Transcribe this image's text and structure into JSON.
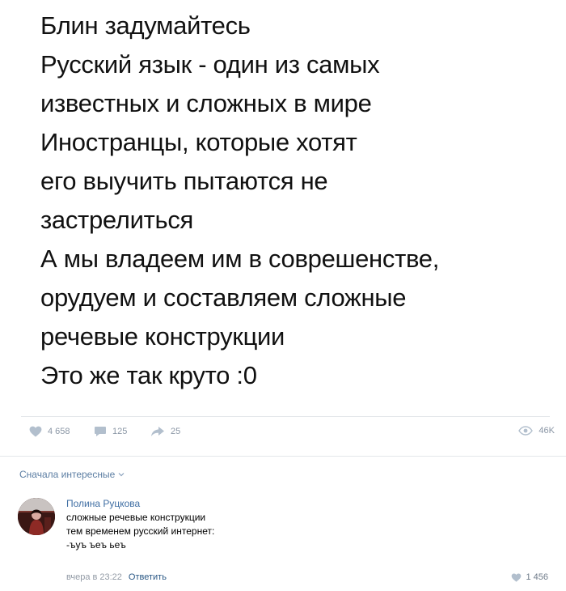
{
  "post": {
    "lines": [
      "Блин задумайтесь",
      "Русский язык - один из самых",
      "известных и сложных в мире",
      "Иностранцы, которые хотят",
      "его выучить пытаются не",
      "застрелиться",
      "А мы владеем им в соврешенстве,",
      "орудуем и составляем сложные",
      "речевые конструкции",
      "Это же так круто :0"
    ]
  },
  "actions": {
    "likes": "4 658",
    "comments": "125",
    "shares": "25",
    "views": "46K",
    "icons": [
      "heart-icon",
      "comment-icon",
      "share-icon",
      "eye-icon"
    ]
  },
  "comments_sort": {
    "label": "Сначала интересные"
  },
  "comment": {
    "author": "Полина Руцкова",
    "lines": [
      "сложные речевые конструкции",
      "тем временем русский интернет:",
      "-ъуъ ъеъ ьеъ"
    ],
    "time": "вчера в 23:22",
    "reply_label": "Ответить",
    "likes": "1 456"
  },
  "colors": {
    "link": "#2a5885",
    "icon": "#b2bfcd",
    "meta": "#939ba6"
  }
}
